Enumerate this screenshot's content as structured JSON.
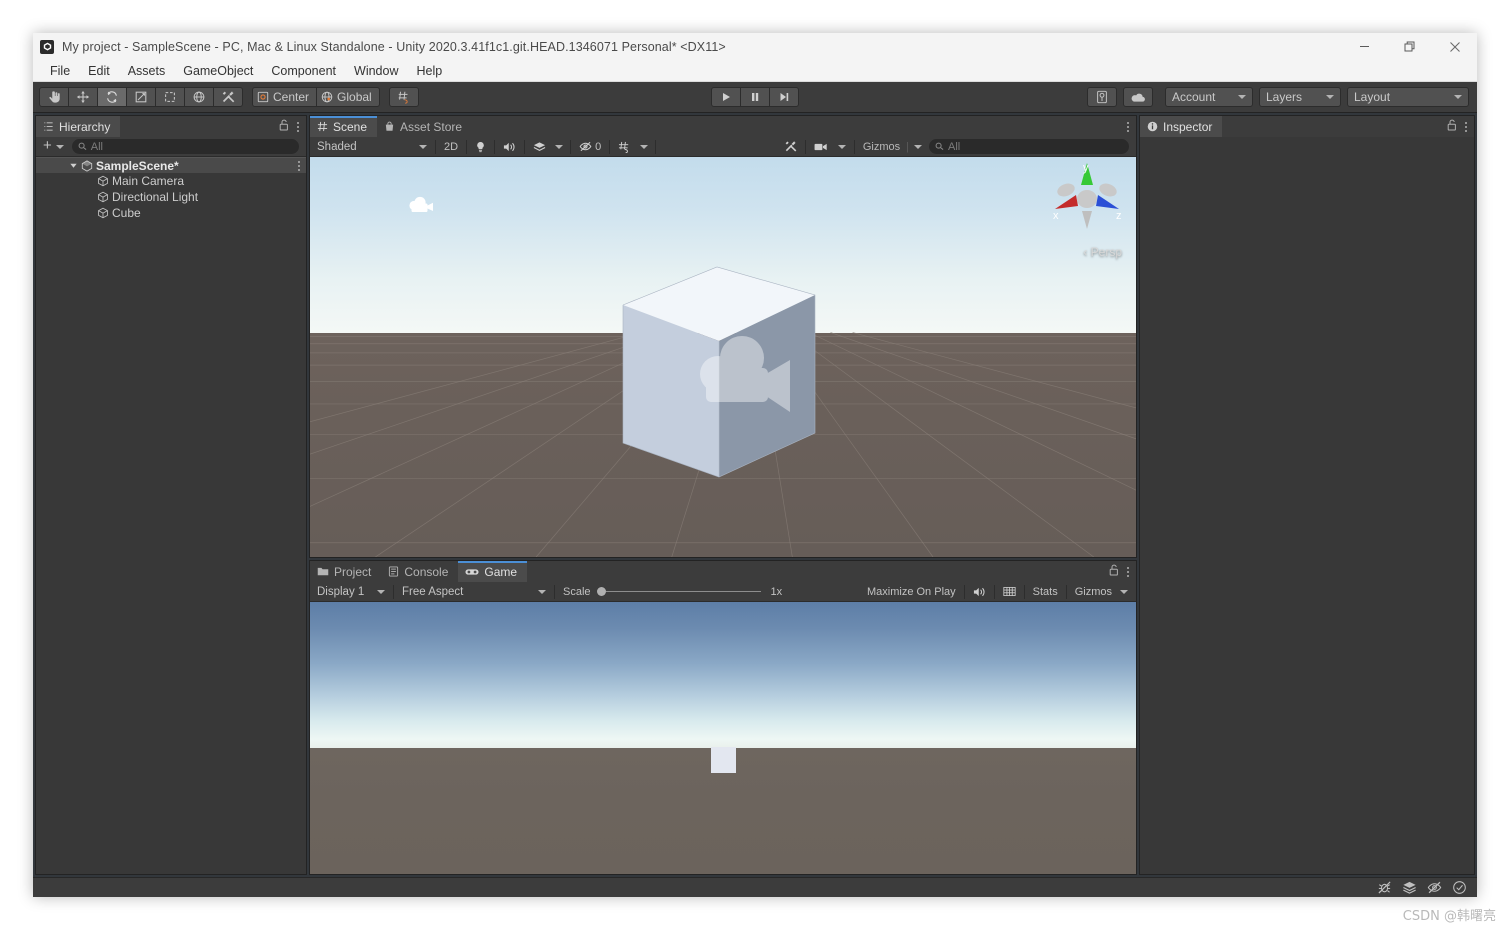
{
  "window": {
    "title": "My project - SampleScene - PC, Mac & Linux Standalone - Unity 2020.3.41f1c1.git.HEAD.1346071 Personal* <DX11>",
    "app_icon": "unity-icon",
    "minimize": "minimize-icon",
    "restore": "restore-icon",
    "close": "close-icon"
  },
  "menubar": {
    "items": [
      {
        "label": "File"
      },
      {
        "label": "Edit"
      },
      {
        "label": "Assets"
      },
      {
        "label": "GameObject"
      },
      {
        "label": "Component"
      },
      {
        "label": "Window"
      },
      {
        "label": "Help"
      }
    ]
  },
  "toolbar": {
    "tools": [
      {
        "name": "hand-tool",
        "icon": "hand-icon",
        "active": false
      },
      {
        "name": "move-tool",
        "icon": "move-icon",
        "active": false
      },
      {
        "name": "rotate-tool",
        "icon": "rotate-icon",
        "active": true
      },
      {
        "name": "scale-tool",
        "icon": "scale-icon",
        "active": false
      },
      {
        "name": "rect-tool",
        "icon": "rect-icon",
        "active": false
      },
      {
        "name": "transform-tool",
        "icon": "transform-icon",
        "active": false
      },
      {
        "name": "custom-tool",
        "icon": "wrench-icon",
        "active": false
      }
    ],
    "pivot_label": "Center",
    "pivot_icon": "pivot-center-icon",
    "handle_label": "Global",
    "handle_icon": "globe-icon",
    "snap_icon": "grid-snap-icon",
    "play": "play-icon",
    "pause": "pause-icon",
    "step": "step-icon",
    "collab_icon": "collab-icon",
    "cloud_icon": "cloud-icon",
    "account_label": "Account",
    "layers_label": "Layers",
    "layout_label": "Layout"
  },
  "hierarchy": {
    "tab_label": "Hierarchy",
    "tab_icon": "hierarchy-icon",
    "lock_icon": "lock-open-icon",
    "menu_icon": "kebab-menu-icon",
    "add_label": "+",
    "search_placeholder": "All",
    "search_icon": "search-icon",
    "scene_name": "SampleScene*",
    "scene_icon": "unity-scene-icon",
    "objects": [
      {
        "label": "Main Camera",
        "icon": "gameobject-icon"
      },
      {
        "label": "Directional Light",
        "icon": "gameobject-icon"
      },
      {
        "label": "Cube",
        "icon": "gameobject-icon"
      }
    ]
  },
  "scene_panel": {
    "tabs": [
      {
        "label": "Scene",
        "icon": "scene-grid-icon",
        "active": true
      },
      {
        "label": "Asset Store",
        "icon": "store-bag-icon",
        "active": false
      }
    ],
    "menu_icon": "kebab-menu-icon",
    "shading_mode": "Shaded",
    "toggle_2d": "2D",
    "light_icon": "lightbulb-icon",
    "audio_icon": "speaker-icon",
    "fx_icon": "effects-icon",
    "hidden_count": "0",
    "visibility_icon": "eye-off-icon",
    "grid_icon": "grid-visibility-icon",
    "tools_icon": "wrench-icon",
    "camera_icon": "camera-icon",
    "gizmos_label": "Gizmos",
    "search_placeholder": "All",
    "search_icon": "search-icon",
    "orientation_gizmo": {
      "axis_x": "x",
      "axis_y": "y",
      "axis_z": "z",
      "x_color": "#c42b2b",
      "y_color": "#2ec42e",
      "z_color": "#2b4fd6",
      "projection_label": "Persp"
    }
  },
  "bottom_panel": {
    "tabs": [
      {
        "label": "Project",
        "icon": "folder-icon",
        "active": false
      },
      {
        "label": "Console",
        "icon": "console-icon",
        "active": false
      },
      {
        "label": "Game",
        "icon": "gamepad-icon",
        "active": true
      }
    ],
    "lock_icon": "lock-open-icon",
    "menu_icon": "kebab-menu-icon",
    "display_label": "Display 1",
    "aspect_label": "Free Aspect",
    "scale_label": "Scale",
    "scale_value": "1x",
    "maximize_label": "Maximize On Play",
    "mute_icon": "speaker-icon",
    "stats_icon": "stats-grid-icon",
    "stats_label": "Stats",
    "gizmos_label": "Gizmos"
  },
  "inspector": {
    "tab_label": "Inspector",
    "tab_icon": "info-icon",
    "lock_icon": "lock-open-icon",
    "menu_icon": "kebab-menu-icon"
  },
  "statusbar": {
    "icons": [
      {
        "name": "bug-off-icon"
      },
      {
        "name": "layers-icon"
      },
      {
        "name": "eye-off-status-icon"
      },
      {
        "name": "check-circle-icon"
      }
    ]
  },
  "watermark": {
    "text": "CSDN @韩曙亮"
  },
  "colors": {
    "accent_blue": "#4b8fd6",
    "panel_bg": "#383838",
    "toolbar_bg": "#3c3c3c",
    "titlebar_bg": "#f4f4f4",
    "scene_ground": "#6a605a",
    "game_sky_top": "#5d7ea7",
    "cube_light": "#e3e7f0"
  }
}
